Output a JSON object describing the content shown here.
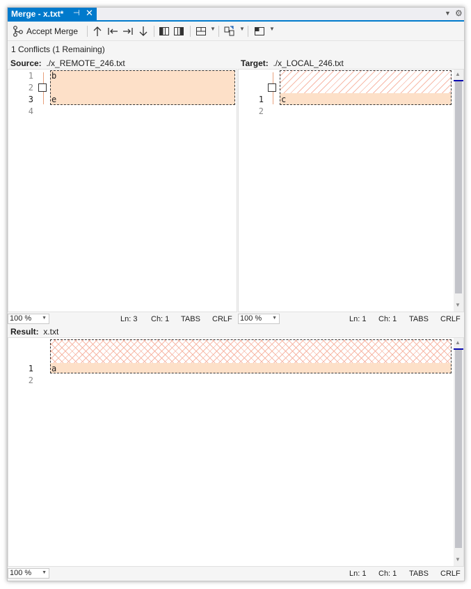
{
  "tab": {
    "title": "Merge - x.txt*",
    "pin_glyph": "⊣",
    "close_glyph": "✕"
  },
  "toolbar": {
    "accept_label": "Accept Merge",
    "icons": [
      "merge-icon",
      "arrow-up-icon",
      "arrow-left-bar-icon",
      "arrow-right-bar-icon",
      "arrow-down-icon",
      "vertical-split-icon",
      "side-split-icon",
      "layout-grid-icon",
      "sync-icon",
      "window-layout-icon"
    ]
  },
  "conflicts": "1 Conflicts (1 Remaining)",
  "source": {
    "label": "Source:",
    "file": "./x_REMOTE_246.txt",
    "line_numbers": [
      "1",
      "2",
      "3",
      "4"
    ],
    "lines": [
      "b",
      "",
      "e",
      ""
    ],
    "status": {
      "zoom": "100 %",
      "ln": "Ln: 3",
      "ch": "Ch: 1",
      "tabs": "TABS",
      "eol": "CRLF"
    }
  },
  "target": {
    "label": "Target:",
    "file": "./x_LOCAL_246.txt",
    "line_numbers": [
      "1",
      "2"
    ],
    "lines": [
      "c",
      ""
    ],
    "status": {
      "zoom": "100 %",
      "ln": "Ln: 1",
      "ch": "Ch: 1",
      "tabs": "TABS",
      "eol": "CRLF"
    }
  },
  "result": {
    "label": "Result:",
    "file": "x.txt",
    "line_numbers": [
      "1",
      "2"
    ],
    "lines": [
      "a",
      ""
    ],
    "status": {
      "zoom": "100 %",
      "ln": "Ln: 1",
      "ch": "Ch: 1",
      "tabs": "TABS",
      "eol": "CRLF"
    }
  },
  "colors": {
    "accent": "#007acc",
    "conflict": "#fde0c8",
    "hatch": "#f7b9a8",
    "marker": "#0a0ab0"
  }
}
